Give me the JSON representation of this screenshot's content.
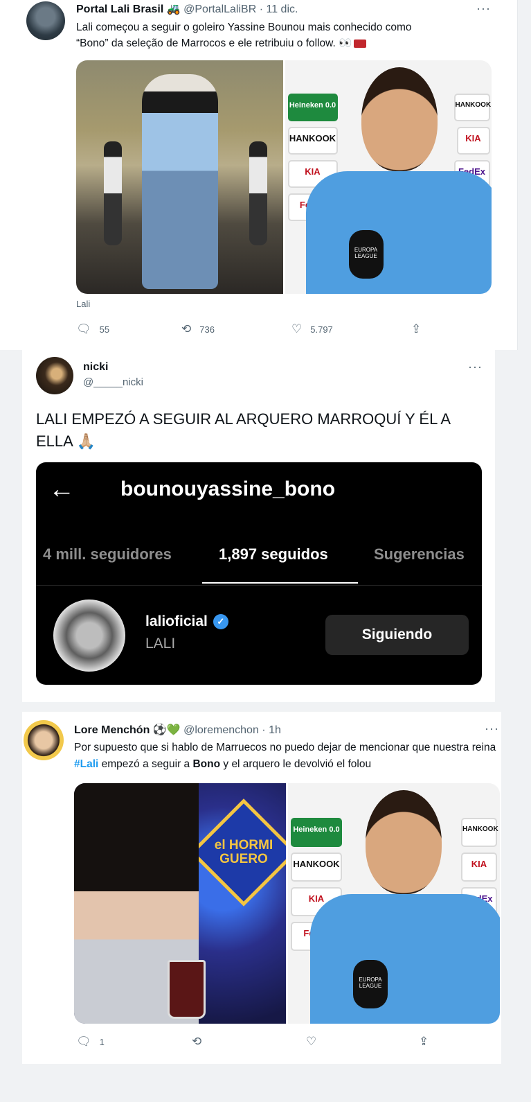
{
  "tweet1": {
    "name": "Portal Lali Brasil",
    "name_emoji": "🚜",
    "handle": "@PortalLaliBR",
    "date": "· 11 dic.",
    "more": "···",
    "text_line1": "Lali começou a seguir o goleiro Yassine Bounou mais conhecido como",
    "text_line2": "“Bono” da seleção de Marrocos e ele retribuiu o follow. 👀",
    "caption": "Lali",
    "replies": "55",
    "retweets": "736",
    "likes": "5.797",
    "sponsors": [
      "Heineken 0.0",
      "HANKOOK",
      "KIA",
      "Fe",
      "KIA",
      "FedEx",
      "HANKOOK",
      "EUROPA"
    ],
    "mic_label": "EUROPA LEAGUE"
  },
  "tweet2": {
    "name": "nicki",
    "handle": "@_____nicki",
    "more": "···",
    "text": "LALI EMPEZÓ A SEGUIR AL ARQUERO MARROQUÍ Y ÉL A ELLA 🙏🏼",
    "instagram": {
      "username": "bounouyassine_bono",
      "tabs": [
        "4 mill. seguidores",
        "1,897 seguidos",
        "Sugerencias"
      ],
      "active_tab": 1,
      "profile_username": "lalioficial",
      "profile_fullname": "LALI",
      "follow_button": "Siguiendo",
      "back": "←",
      "verified": "✓"
    }
  },
  "tweet3": {
    "name": "Lore Menchón",
    "name_emoji": "⚽💚",
    "handle": "@loremenchon",
    "date": "· 1h",
    "more": "···",
    "text_prefix": "Por supuesto que si hablo de Marruecos no puedo dejar de mencionar que nuestra reina ",
    "hashtag": "#Lali",
    "text_mid": " empezó a seguir a ",
    "bold_word": "Bono",
    "text_suffix": " y el arquero le devolvió el folou",
    "tv_logo": "el HORMI GUERO",
    "replies": "1"
  },
  "icons": {
    "reply": "reply-icon",
    "retweet": "retweet-icon",
    "like": "heart-icon",
    "share": "share-icon"
  }
}
